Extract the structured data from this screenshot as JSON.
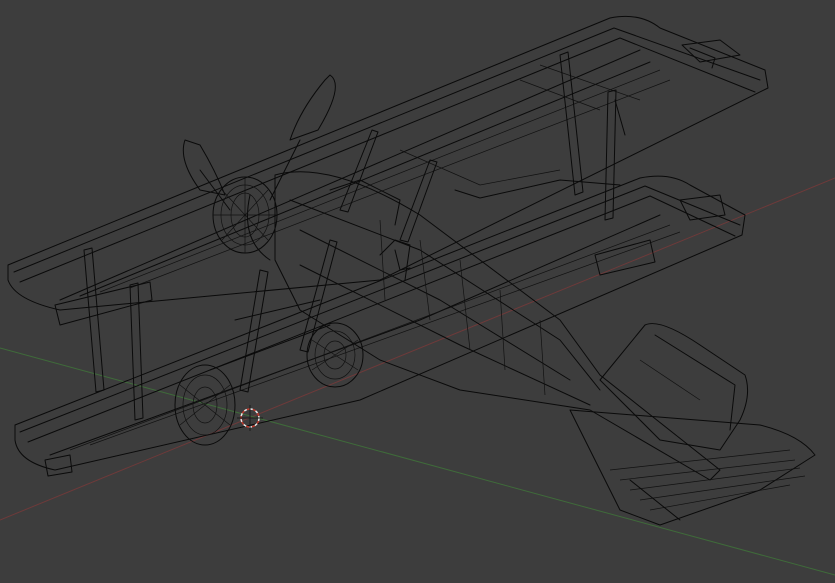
{
  "viewport": {
    "background_color": "#3d3d3d",
    "wire_color": "#0a0a0a",
    "x_axis_color": "#6e3a3a",
    "y_axis_color": "#3f6b3a",
    "object": "biplane-wireframe",
    "shading": "wireframe"
  }
}
